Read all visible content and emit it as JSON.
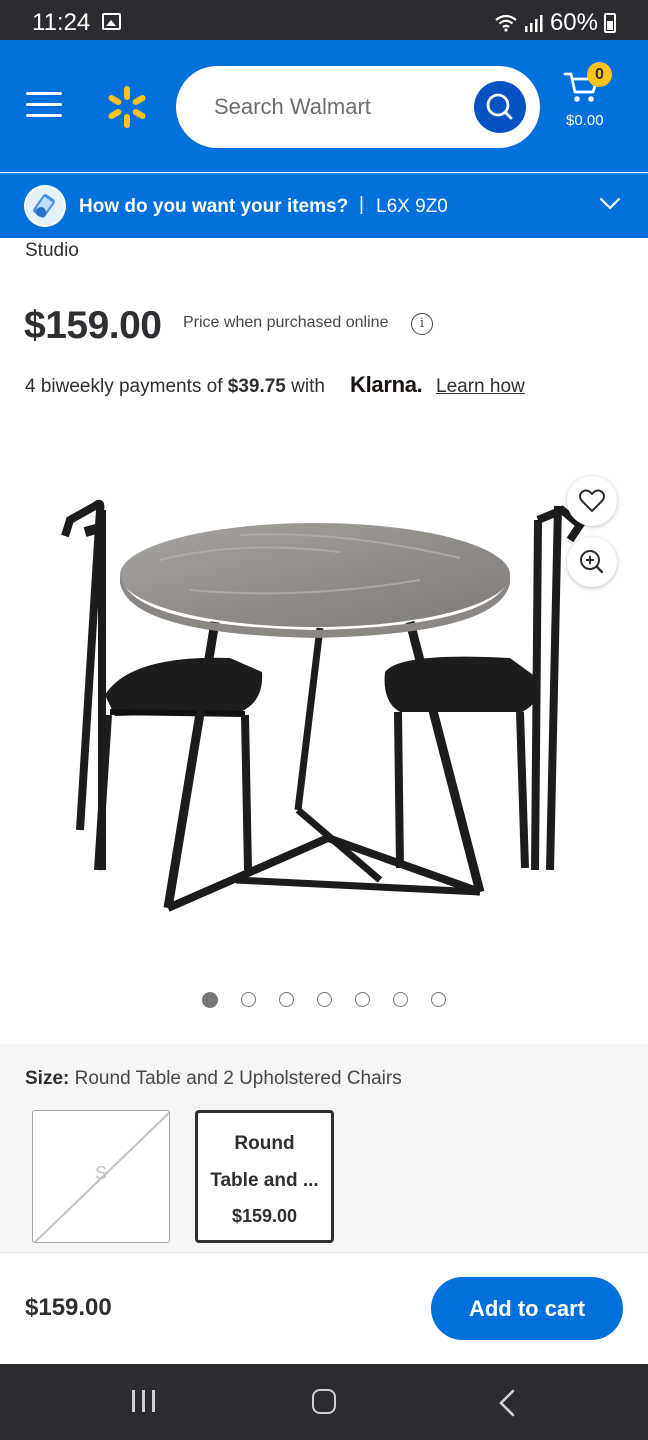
{
  "status_bar": {
    "time": "11:24",
    "battery": "60%"
  },
  "header": {
    "search_placeholder": "Search Walmart",
    "cart_count": "0",
    "cart_total": "$0.00"
  },
  "fulfillment": {
    "question": "How do you want your items?",
    "separator": "|",
    "postal_code": "L6X 9Z0"
  },
  "product": {
    "brand_fragment": "Studio",
    "price": "$159.00",
    "price_note": "Price when purchased online",
    "klarna": {
      "prefix": "4 biweekly payments of ",
      "amount": "$39.75",
      "suffix": " with",
      "logo": "Klarna.",
      "learn_how": "Learn how"
    },
    "image_count": 7,
    "active_image_index": 0
  },
  "size": {
    "label": "Size:",
    "selected_value": "Round Table and 2 Upholstered Chairs",
    "options": [
      {
        "label": "S",
        "available": false
      },
      {
        "line1": "Round",
        "line2": "Table and ...",
        "price": "$159.00",
        "selected": true
      }
    ]
  },
  "bottom_bar": {
    "price": "$159.00",
    "add_to_cart": "Add to cart"
  },
  "colors": {
    "brand_blue": "#0071dc",
    "spark_yellow": "#ffc220",
    "search_button": "#0652c2"
  }
}
